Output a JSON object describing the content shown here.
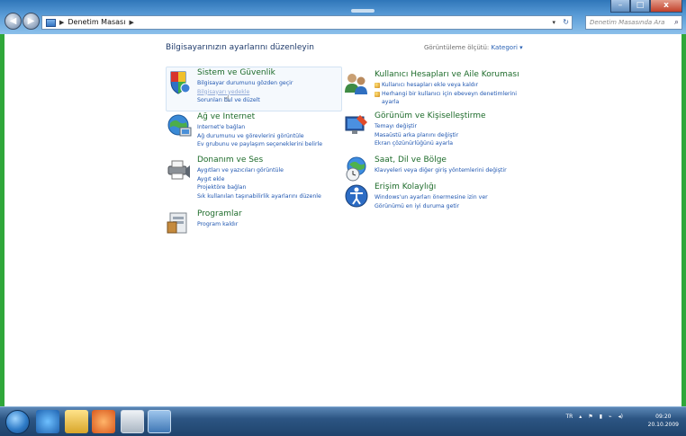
{
  "window": {
    "address_segments": [
      "Denetim Masası"
    ],
    "search_placeholder": "Denetim Masasında Ara"
  },
  "main": {
    "heading": "Bilgisayarınızın ayarlarını düzenleyin",
    "view_by_label": "Görüntüleme ölçütü:",
    "view_by_value": "Kategori ▾"
  },
  "categories_left": [
    {
      "title": "Sistem ve Güvenlik",
      "links": [
        "Bilgisayar durumunu gözden geçir",
        "Bilgisayarı yedekle",
        "Sorunları bul ve düzelt"
      ]
    },
    {
      "title": "Ağ ve Internet",
      "links": [
        "Internet'e bağlan",
        "Ağ durumunu ve görevlerini görüntüle",
        "Ev grubunu ve paylaşım seçeneklerini belirle"
      ]
    },
    {
      "title": "Donanım ve Ses",
      "links": [
        "Aygıtları ve yazıcıları görüntüle",
        "Aygıt ekle",
        "Projektöre bağlan",
        "Sık kullanılan taşınabilirlik ayarlarını düzenle"
      ]
    },
    {
      "title": "Programlar",
      "links": [
        "Program kaldır"
      ]
    }
  ],
  "categories_right": [
    {
      "title": "Kullanıcı Hesapları ve Aile Koruması",
      "links": [
        "Kullanıcı hesapları ekle veya kaldır",
        "Herhangi bir kullanıcı için ebeveyn denetimlerini ayarla"
      ]
    },
    {
      "title": "Görünüm ve Kişiselleştirme",
      "links": [
        "Temayı değiştir",
        "Masaüstü arka planını değiştir",
        "Ekran çözünürlüğünü ayarla"
      ]
    },
    {
      "title": "Saat, Dil ve Bölge",
      "links": [
        "Klavyeleri veya diğer giriş yöntemlerini değiştir"
      ]
    },
    {
      "title": "Erişim Kolaylığı",
      "links": [
        "Windows'un ayarları önermesine izin ver",
        "Görünümü en iyi duruma getir"
      ]
    }
  ],
  "taskbar": {
    "lang": "TR",
    "time": "09:20",
    "date": "20.10.2009"
  },
  "colors": {
    "title_green": "#1d6b2a",
    "link_blue": "#1f56b0",
    "frame_green": "#2fa73a"
  }
}
